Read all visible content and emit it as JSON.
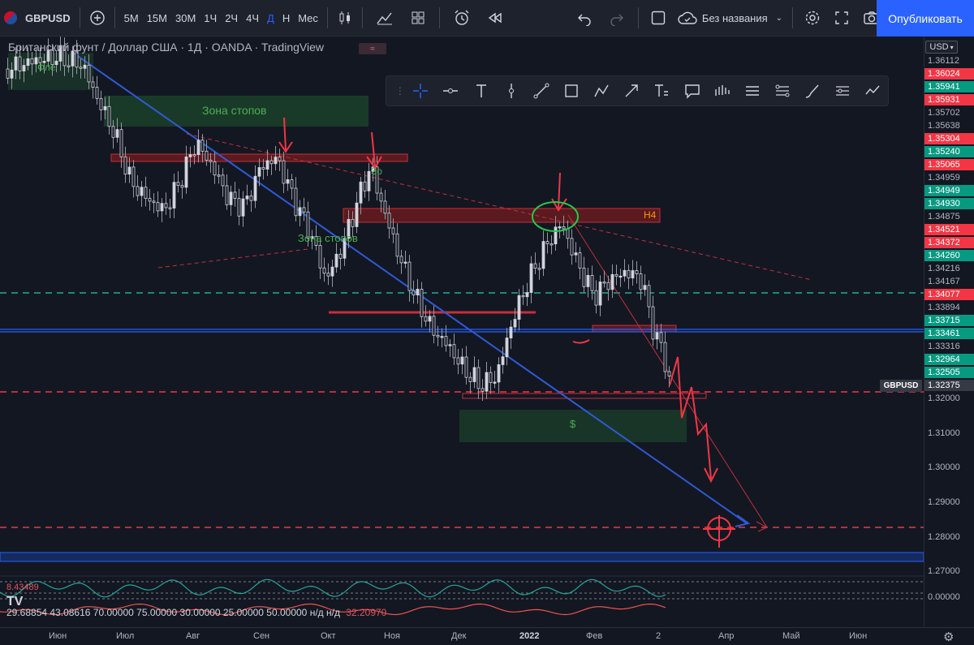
{
  "topbar": {
    "symbol": "GBPUSD",
    "timeframes": [
      "5M",
      "15M",
      "30M",
      "1Ч",
      "2Ч",
      "4Ч",
      "Д",
      "Н",
      "Мес"
    ],
    "active_timeframe": "Д",
    "layout_name": "Без названия",
    "publish_label": "Опубликовать"
  },
  "legend": {
    "title": "Британский фунт / Доллар США · 1Д · OANDA · TradingView",
    "badge": "≈"
  },
  "price_axis": {
    "currency": "USD",
    "symbol_tag": "GBPUSD",
    "labels": [
      {
        "text": "1.36112",
        "color": "#787b86"
      },
      {
        "text": "1.36024",
        "color": "#f23645"
      },
      {
        "text": "1.35941",
        "color": "#089981"
      },
      {
        "text": "1.35931",
        "color": "#f23645"
      },
      {
        "text": "1.35702",
        "color": "#787b86"
      },
      {
        "text": "1.35638",
        "color": "#787b86"
      },
      {
        "text": "1.35304",
        "color": "#f23645"
      },
      {
        "text": "1.35240",
        "color": "#089981"
      },
      {
        "text": "1.35065",
        "color": "#f23645"
      },
      {
        "text": "1.34959",
        "color": "#787b86"
      },
      {
        "text": "1.34949",
        "color": "#089981"
      },
      {
        "text": "1.34930",
        "color": "#089981"
      },
      {
        "text": "1.34875",
        "color": "#787b86"
      },
      {
        "text": "1.34521",
        "color": "#f23645"
      },
      {
        "text": "1.34372",
        "color": "#f23645"
      },
      {
        "text": "1.34260",
        "color": "#089981"
      },
      {
        "text": "1.34216",
        "color": "#787b86"
      },
      {
        "text": "1.34167",
        "color": "#787b86"
      },
      {
        "text": "1.34077",
        "color": "#f23645"
      },
      {
        "text": "1.33894",
        "color": "#787b86"
      },
      {
        "text": "1.33715",
        "color": "#089981"
      },
      {
        "text": "1.33461",
        "color": "#089981"
      },
      {
        "text": "1.33316",
        "color": "#787b86"
      },
      {
        "text": "1.32964",
        "color": "#089981"
      },
      {
        "text": "1.32505",
        "color": "#089981"
      },
      {
        "text": "1.32375",
        "color": "#363a45"
      }
    ],
    "scale": [
      "1.32000",
      "1.31000",
      "1.30000",
      "1.29000",
      "1.28000",
      "1.27000"
    ],
    "ind_scale": "0.00000"
  },
  "time_axis": [
    "Июн",
    "Июл",
    "Авг",
    "Сен",
    "Окт",
    "Ноя",
    "Дек",
    "2022",
    "Фев",
    "2",
    "Апр",
    "Май",
    "Июн"
  ],
  "annotations": {
    "stop_zone_1": "Зона стопов",
    "stop_zone_2": "Зона стопов",
    "dollar": "$",
    "h4": "H4",
    "zo": "Зо",
    "fle": "Фле"
  },
  "indicators": {
    "top_value": "8.43489",
    "values": "29.68854  43.08616  70.00000  75.00000  30.00000  25.00000  50.00000  н/д  н/д",
    "last_value": "32.20970"
  },
  "chart_data": {
    "type": "candlestick",
    "symbol": "GBPUSD",
    "interval": "1Д",
    "last_price": 1.32375,
    "scale_ticks": [
      1.32,
      1.31,
      1.3,
      1.29,
      1.28,
      1.27
    ],
    "key_levels": [
      1.34077,
      1.33894,
      1.32375,
      1.2825,
      1.275
    ],
    "projected_target": 1.2825
  }
}
